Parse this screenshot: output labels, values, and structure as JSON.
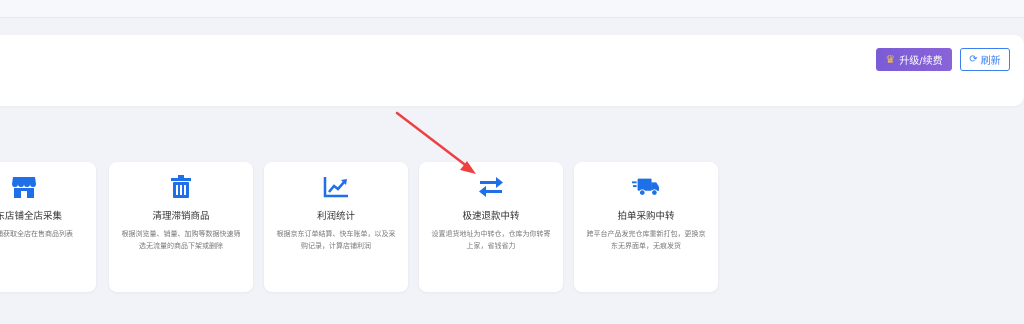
{
  "header": {
    "upgrade_label": "升级/续费",
    "refresh_label": "刷新"
  },
  "cards": [
    {
      "title": "京东店铺全店采集",
      "desc": "京东店铺获取全店在售商品列表",
      "icon": "store-icon"
    },
    {
      "title": "清理滞销商品",
      "desc": "根据浏览量、销量、加购等数据快速筛选无流量的商品下架或删除",
      "icon": "trash-icon"
    },
    {
      "title": "利润统计",
      "desc": "根据京东订单结算、快车账单，以及采购记录，计算店铺利润",
      "icon": "chart-icon"
    },
    {
      "title": "极速退款中转",
      "desc": "设置退货地址为中转仓，仓库为你转寄上家，省钱省力",
      "icon": "transfer-icon"
    },
    {
      "title": "拍单采购中转",
      "desc": "跨平台产品发完仓库重新打包，更换京东无界面单，无痕发货",
      "icon": "truck-icon"
    }
  ],
  "colors": {
    "accent": "#1e6fe8",
    "upgrade": "#7a5cd6",
    "annotation_arrow": "#ee4040"
  }
}
